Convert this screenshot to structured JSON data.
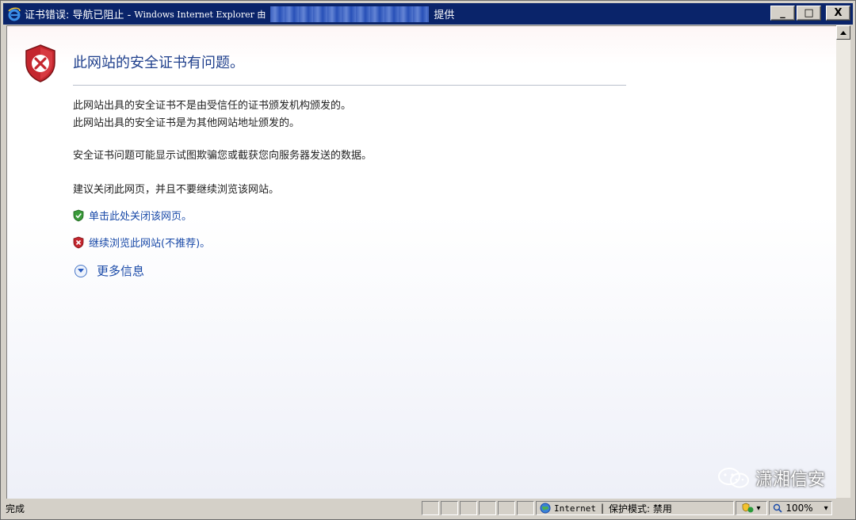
{
  "window": {
    "title_prefix": "证书错误: 导航已阻止 -",
    "title_app": "Windows Internet Explorer 由",
    "title_suffix": "提供",
    "minimize_label": "_",
    "maximize_label": "□",
    "close_label": "X"
  },
  "page": {
    "heading": "此网站的安全证书有问题。",
    "paragraph_lines": [
      "此网站出具的安全证书不是由受信任的证书颁发机构颁发的。",
      "此网站出具的安全证书是为其他网站地址颁发的。"
    ],
    "warning_text": "安全证书问题可能显示试图欺骗您或截获您向服务器发送的数据。",
    "recommend_text": "建议关闭此网页，并且不要继续浏览该网站。",
    "close_link": "单击此处关闭该网页。",
    "continue_link": "继续浏览此网站(不推荐)。",
    "more_info": "更多信息"
  },
  "watermark": {
    "text": "潇湘信安"
  },
  "statusbar": {
    "status_text": "完成",
    "zone_name": "Internet",
    "separator": "|",
    "protected_mode": "保护模式: 禁用",
    "zoom": "100%",
    "dropdown_glyph": "▾"
  },
  "colors": {
    "titlebar": "#0a246a",
    "link": "#1a4aa8",
    "heading": "#1f3f8c",
    "shield_red": "#c4262e",
    "shield_green": "#3a9a3a"
  }
}
